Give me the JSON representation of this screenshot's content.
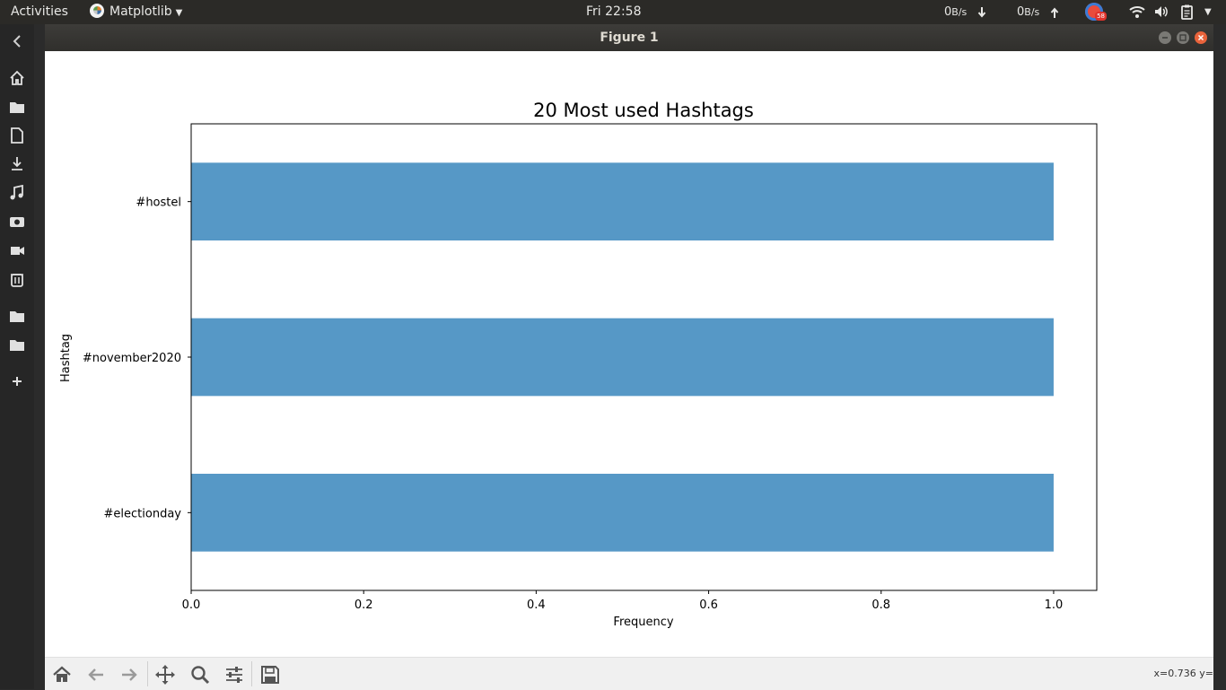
{
  "topbar": {
    "activities": "Activities",
    "app_name": "Matplotlib",
    "clock": "Fri 22:58",
    "net_down_value": "0",
    "net_down_unit": "B/s",
    "net_up_value": "0",
    "net_up_unit": "B/s",
    "badge_count": "58"
  },
  "window": {
    "title": "Figure 1"
  },
  "toolbar": {
    "coords": "x=0.736 y="
  },
  "icons": {
    "dock": [
      "back-icon",
      "home-folder-icon",
      "folder-icon",
      "document-icon",
      "downloads-icon",
      "music-icon",
      "pictures-icon",
      "videos-icon",
      "trash-icon",
      "folder-icon",
      "folder-icon",
      "add-icon"
    ],
    "toolbar": [
      "home-icon",
      "back-arrow-icon",
      "forward-arrow-icon",
      "pan-icon",
      "zoom-icon",
      "configure-subplots-icon",
      "save-icon"
    ]
  },
  "colors": {
    "bar": "#5698c6",
    "topbar": "#2b2a27",
    "close_button": "#e9633b"
  },
  "chart_data": {
    "type": "bar",
    "orientation": "horizontal",
    "title": "20 Most used Hashtags",
    "xlabel": "Frequency",
    "ylabel": "Hashtag",
    "categories": [
      "#electionday",
      "#november2020",
      "#hostel"
    ],
    "values": [
      1.0,
      1.0,
      1.0
    ],
    "xlim": [
      0,
      1.05
    ],
    "xticks": [
      "0.0",
      "0.2",
      "0.4",
      "0.6",
      "0.8",
      "1.0"
    ],
    "grid": false,
    "legend": "none"
  }
}
